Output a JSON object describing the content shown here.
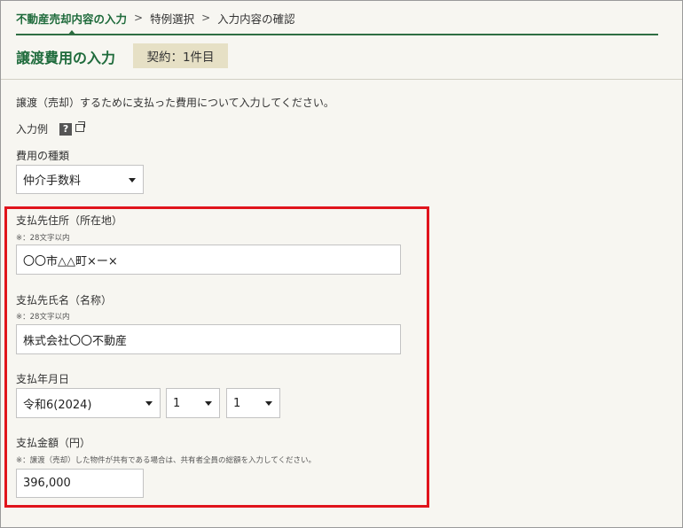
{
  "breadcrumb": {
    "current": "不動産売却内容の入力",
    "step2": "特例選択",
    "step3": "入力内容の確認",
    "separator": ">"
  },
  "page": {
    "title": "譲渡費用の入力",
    "badge": "契約：1件目",
    "intro": "譲渡（売却）するために支払った費用について入力してください。",
    "example_label": "入力例",
    "help_icon_text": "?"
  },
  "form": {
    "type": {
      "label": "費用の種類",
      "value": "仲介手数料"
    },
    "address": {
      "label": "支払先住所（所在地）",
      "note": "※：28文字以内",
      "value": "〇〇市△△町×ー×"
    },
    "name": {
      "label": "支払先氏名（名称）",
      "note": "※：28文字以内",
      "value": "株式会社〇〇不動産"
    },
    "date": {
      "label": "支払年月日",
      "era": "令和6(2024)",
      "month": "1",
      "day": "1"
    },
    "amount": {
      "label": "支払金額（円）",
      "note": "※：譲渡（売却）した物件が共有である場合は、共有者全員の総額を入力してください。",
      "value": "396,000"
    }
  },
  "colors": {
    "accent_green": "#1f6b3c",
    "highlight_red": "#e0141c",
    "badge_bg": "#e6e0c5"
  },
  "icons": [
    "help-icon",
    "new-window-icon",
    "dropdown-arrow-icon"
  ]
}
